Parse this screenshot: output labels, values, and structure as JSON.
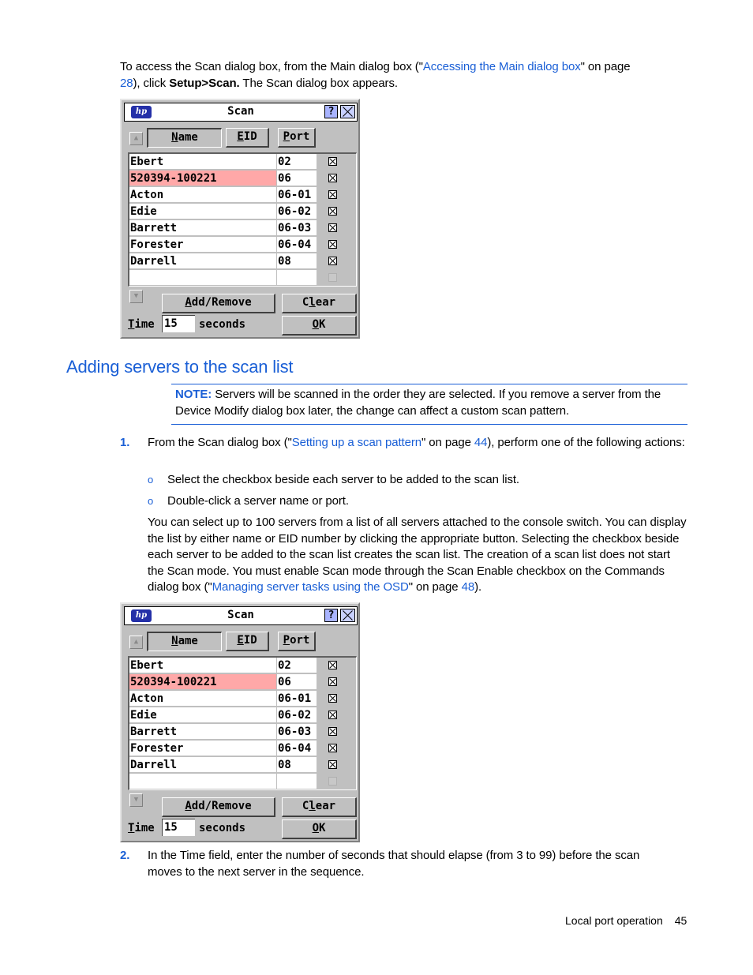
{
  "intro": {
    "text1": "To access the Scan dialog box, from the Main dialog box (\"",
    "link1": "Accessing the Main dialog box",
    "text2": "\" on page",
    "page_link": "28",
    "text3": "), click ",
    "bold": "Setup>Scan.",
    "text4": " The Scan dialog box appears."
  },
  "dialog": {
    "logo": "hp",
    "title": "Scan",
    "help_label": "?",
    "buttons": {
      "name": {
        "u": "N",
        "rest": "ame"
      },
      "eid": {
        "u": "E",
        "rest": "ID"
      },
      "port": {
        "u": "P",
        "rest": "ort"
      },
      "add_remove": {
        "u": "A",
        "rest": "dd/Remove"
      },
      "clear": {
        "pre": "C",
        "u": "l",
        "rest": "ear"
      },
      "ok": {
        "u": "O",
        "rest": "K"
      }
    },
    "rows": [
      {
        "name": "Ebert",
        "eid": "02",
        "checked": true,
        "selected": false
      },
      {
        "name": "520394-100221",
        "eid": "06",
        "checked": true,
        "selected": true
      },
      {
        "name": "Acton",
        "eid": "06-01",
        "checked": true,
        "selected": false
      },
      {
        "name": "Edie",
        "eid": "06-02",
        "checked": true,
        "selected": false
      },
      {
        "name": "Barrett",
        "eid": "06-03",
        "checked": true,
        "selected": false
      },
      {
        "name": "Forester",
        "eid": "06-04",
        "checked": true,
        "selected": false
      },
      {
        "name": "Darrell",
        "eid": "08",
        "checked": true,
        "selected": false
      },
      {
        "name": "",
        "eid": "",
        "checked": false,
        "selected": false,
        "disabled": true
      }
    ],
    "time_label": {
      "u": "T",
      "rest": "ime"
    },
    "time_value": "15",
    "seconds_label": "seconds"
  },
  "section": {
    "heading": "Adding servers to the scan list",
    "note_label": "NOTE:",
    "note_text": " Servers will be scanned in the order they are selected. If you remove a server from the Device Modify dialog box later, the change can affect a custom scan pattern."
  },
  "steps": [
    {
      "num": "1.",
      "text1": "From the Scan dialog box (\"",
      "link": "Setting up a scan pattern",
      "text2": "\" on page ",
      "page": "44",
      "text3": "), perform one of the following actions:",
      "bullets": [
        "Select the checkbox beside each server to be added to the scan list.",
        "Double-click a server name or port."
      ],
      "para1": "You can select up to 100 servers from a list of all servers attached to the console switch. You can display the list by either name or EID number by clicking the appropriate button. Selecting the checkbox beside each server to be added to the scan list creates the scan list. The creation of a scan list does not start the Scan mode. You must enable Scan mode through the Scan Enable checkbox on the Commands dialog box (\"",
      "para_link": "Managing server tasks using the OSD",
      "para2": "\" on page ",
      "para_page": "48",
      "para3": ")."
    },
    {
      "num": "2.",
      "text": "In the Time field, enter the number of seconds that should elapse (from 3 to 99) before the scan moves to the next server in the sequence."
    }
  ],
  "footer": {
    "section": "Local port operation",
    "page": "45"
  },
  "colors": {
    "accent": "#1a5fd6",
    "selected_row": "#ffa8a8",
    "dialog_bg": "#c0c0c0"
  }
}
